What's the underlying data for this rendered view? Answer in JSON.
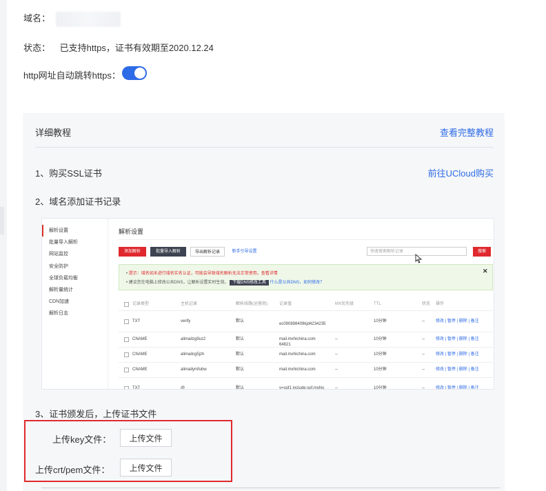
{
  "domain_row": {
    "label": "域名："
  },
  "status_row": {
    "label": "状态：",
    "value": "已支持https，证书有效期至2020.12.24"
  },
  "redirect_row": {
    "label": "http网址自动跳转https：",
    "enabled": true
  },
  "tutorial": {
    "title": "详细教程",
    "full_link": "查看完整教程",
    "step1": "1、购买SSL证书",
    "step1_link": "前往UCloud购买",
    "step2": "2、域名添加证书记录",
    "step3": "3、证书颁发后，上传证书文件"
  },
  "dns_screenshot": {
    "sidebar": [
      "解析设置",
      "批量导入解析",
      "网站监控",
      "安全防护",
      "全球负载均衡",
      "解析量统计",
      "CDN加速",
      "解析日志"
    ],
    "title": "解析设置",
    "buttons": {
      "add": "添加解析",
      "import": "批量导入解析",
      "export": "导出解析记录",
      "guide": "新手引导设置",
      "search": "搜索"
    },
    "search_placeholder": "快速搜索解析记录",
    "notice1": "提示：域名如未进行域名实名认证，可能会导致域名解析无法正常使用。查看详情",
    "notice2": "建议您在电脑上修改公共DNS，让解析设置实时生效。",
    "notice2_btn": "下载DNS修改工具",
    "notice2_link": "什么是公共DNS，如何修改？",
    "columns": [
      "记录类型",
      "主机记录",
      "解析线路(运营商)",
      "记录值",
      "MX优先级",
      "TTL",
      "状态",
      "操作"
    ],
    "rows": [
      {
        "type": "TXT",
        "host": "verify",
        "line": "默认",
        "value1": "ec090898409kjd4234235",
        "value2": "64821",
        "mx": "",
        "ttl": "10分钟",
        "status": "--"
      },
      {
        "type": "CNAME",
        "host": "alimailzg9uz2",
        "line": "默认",
        "value1": "mail.mxhichina.com",
        "value2": "",
        "mx": "--",
        "ttl": "10分钟",
        "status": "--"
      },
      {
        "type": "CNAME",
        "host": "alimailcg5jzh",
        "line": "默认",
        "value1": "mail.mxhichina.com",
        "value2": "",
        "mx": "--",
        "ttl": "10分钟",
        "status": "--"
      },
      {
        "type": "CNAME",
        "host": "alimailymfubw",
        "line": "默认",
        "value1": "mail.mxhichina.com",
        "value2": "",
        "mx": "--",
        "ttl": "10分钟",
        "status": "--"
      },
      {
        "type": "TXT",
        "host": "@",
        "line": "默认",
        "value1": "v=spf1 include:spf.mxhic",
        "value2": "",
        "mx": "--",
        "ttl": "10分钟",
        "status": "--"
      }
    ],
    "ops": "修改 | 暂停 | 删除 | 备注"
  },
  "upload": {
    "key_label": "上传key文件：",
    "crt_label": "上传crt/pem文件：",
    "button": "上传文件"
  },
  "colors": {
    "accent": "#2e6be6",
    "highlight_border": "#e0292e"
  }
}
